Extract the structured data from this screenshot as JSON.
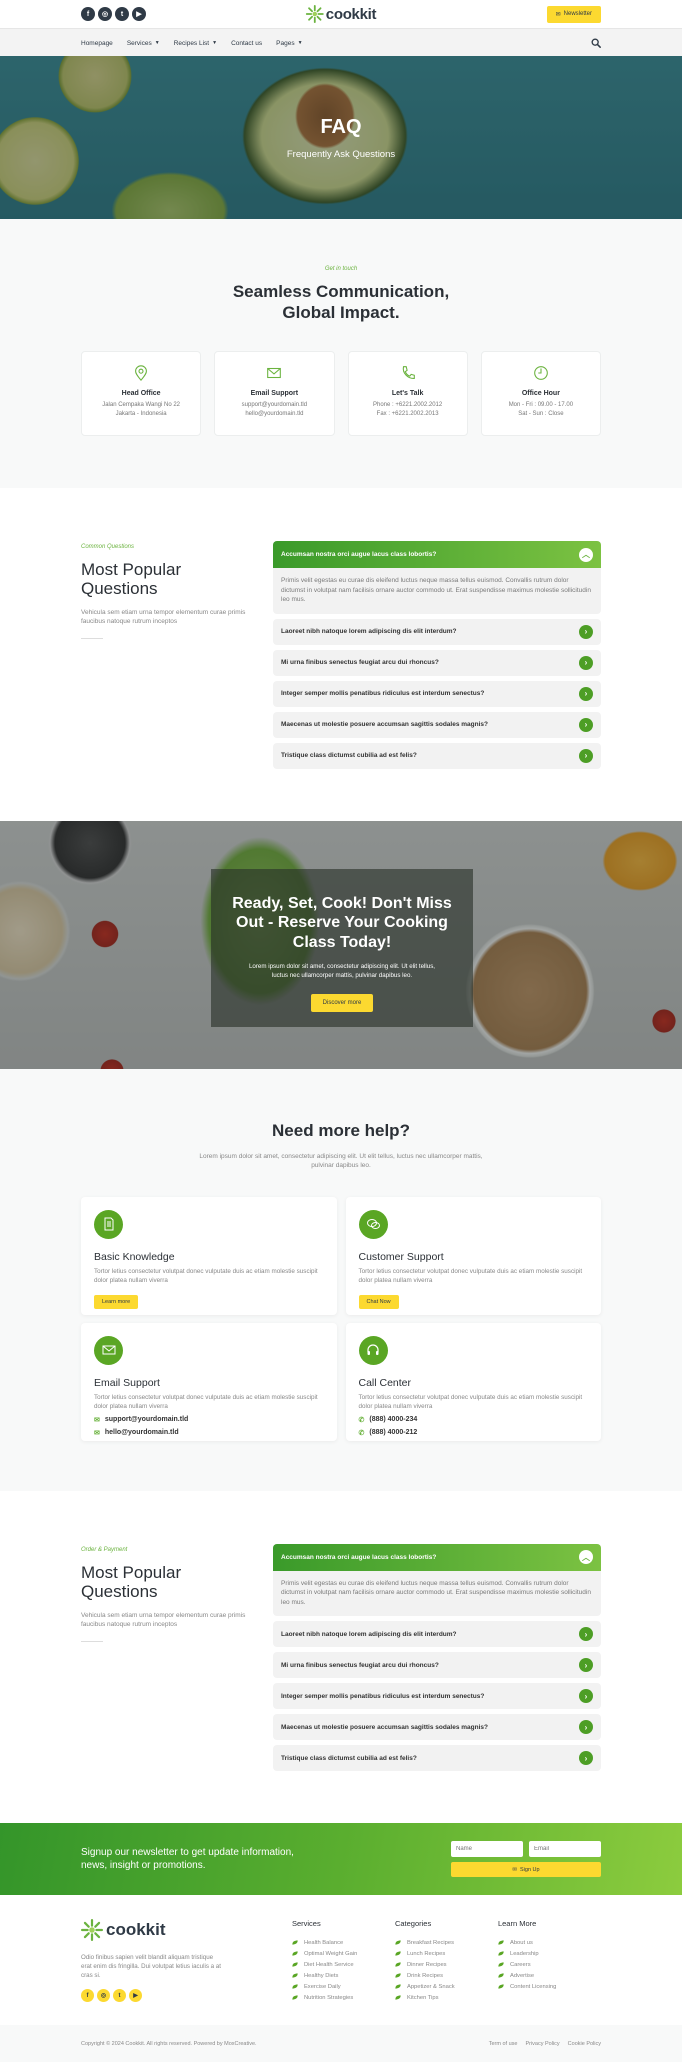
{
  "header": {
    "socials": [
      "facebook",
      "instagram",
      "twitter",
      "youtube"
    ],
    "brand": "cookkit",
    "newsletter_button": "Newsletter",
    "menu": [
      {
        "label": "Homepage",
        "dropdown": false
      },
      {
        "label": "Services",
        "dropdown": true
      },
      {
        "label": "Recipes List",
        "dropdown": true
      },
      {
        "label": "Contact us",
        "dropdown": false
      },
      {
        "label": "Pages",
        "dropdown": true
      }
    ]
  },
  "hero": {
    "title": "FAQ",
    "subtitle": "Frequently Ask Questions"
  },
  "contact": {
    "eyebrow": "Get in touch",
    "title": "Seamless Communication, Global Impact.",
    "cards": [
      {
        "icon": "map-pin-icon",
        "title": "Head Office",
        "lines": [
          "Jalan Cempaka Wangi No 22",
          "Jakarta - Indonesia"
        ]
      },
      {
        "icon": "envelope-icon",
        "title": "Email Support",
        "lines": [
          "support@yourdomain.tld",
          "hello@yourdomain.tld"
        ]
      },
      {
        "icon": "phone-icon",
        "title": "Let's Talk",
        "lines": [
          "Phone : +6221.2002.2012",
          "Fax : +6221.2002.2013"
        ]
      },
      {
        "icon": "clock-icon",
        "title": "Office Hour",
        "lines": [
          "Mon - Fri : 09.00 - 17.00",
          "Sat - Sun : Close"
        ]
      }
    ]
  },
  "faq1": {
    "eyebrow": "Common Questions",
    "title": "Most Popular Questions",
    "desc": "Vehicula sem etiam urna tempor elementum curae primis faucibus natoque rutrum inceptos",
    "open": {
      "question": "Accumsan nostra orci augue lacus class lobortis?",
      "answer": "Primis velit egestas eu curae dis eleifend luctus neque massa tellus euismod. Convallis rutrum dolor dictumst in volutpat nam facilisis ornare auctor commodo ut. Erat suspendisse maximus molestie sollicitudin leo mus."
    },
    "items": [
      "Laoreet nibh natoque lorem adipiscing dis elit interdum?",
      "Mi urna finibus senectus feugiat arcu dui rhoncus?",
      "Integer semper mollis penatibus ridiculus est interdum senectus?",
      "Maecenas ut molestie posuere accumsan sagittis sodales magnis?",
      "Tristique class dictumst cubilia ad est felis?"
    ]
  },
  "cta": {
    "title": "Ready, Set, Cook! Don't Miss Out - Reserve Your Cooking Class Today!",
    "text": "Lorem ipsum dolor sit amet, consectetur adipiscing elit. Ut elit tellus, luctus nec ullamcorper mattis, pulvinar dapibus leo.",
    "button": "Discover more"
  },
  "help": {
    "title": "Need more help?",
    "subtitle": "Lorem ipsum dolor sit amet, consectetur adipiscing elit. Ut elit tellus, luctus nec ullamcorper mattis, pulvinar dapibus leo.",
    "cards": [
      {
        "icon": "document-icon",
        "title": "Basic Knowledge",
        "text": "Tortor letius consectetur volutpat donec vulputate duis ac etiam molestie suscipit dolor platea nullam viverra",
        "button": "Learn more"
      },
      {
        "icon": "chat-bubbles-icon",
        "title": "Customer Support",
        "text": "Tortor letius consectetur volutpat donec vulputate duis ac etiam molestie suscipit dolor platea nullam viverra",
        "button": "Chat Now"
      },
      {
        "icon": "envelope-icon",
        "title": "Email Support",
        "text": "Tortor letius consectetur volutpat donec vulputate duis ac etiam molestie suscipit dolor platea nullam viverra",
        "contacts": [
          "support@yourdomain.tld",
          "hello@yourdomain.tld"
        ]
      },
      {
        "icon": "headset-icon",
        "title": "Call Center",
        "text": "Tortor letius consectetur volutpat donec vulputate duis ac etiam molestie suscipit dolor platea nullam viverra",
        "contacts": [
          "(888) 4000-234",
          "(888) 4000-212"
        ]
      }
    ]
  },
  "faq2": {
    "eyebrow": "Order & Payment",
    "title": "Most Popular Questions",
    "desc": "Vehicula sem etiam urna tempor elementum curae primis faucibus natoque rutrum inceptos",
    "open": {
      "question": "Accumsan nostra orci augue lacus class lobortis?",
      "answer": "Primis velit egestas eu curae dis eleifend luctus neque massa tellus euismod. Convallis rutrum dolor dictumst in volutpat nam facilisis ornare auctor commodo ut. Erat suspendisse maximus molestie sollicitudin leo mus."
    },
    "items": [
      "Laoreet nibh natoque lorem adipiscing dis elit interdum?",
      "Mi urna finibus senectus feugiat arcu dui rhoncus?",
      "Integer semper mollis penatibus ridiculus est interdum senectus?",
      "Maecenas ut molestie posuere accumsan sagittis sodales magnis?",
      "Tristique class dictumst cubilia ad est felis?"
    ]
  },
  "newsletter": {
    "message": "Signup our newsletter to get update information, news, insight or promotions.",
    "name_placeholder": "Name",
    "email_placeholder": "Email",
    "button": "Sign Up"
  },
  "footer": {
    "brand": "cookkit",
    "about": "Odio finibus sapien velit blandit aliquam tristique erat enim dis fringilla. Dui volutpat letius iaculis a at cras si.",
    "columns": [
      {
        "title": "Services",
        "links": [
          "Health Balance",
          "Optimal Weight Gain",
          "Diet Health Service",
          "Healthy Diets",
          "Exercise Daily",
          "Nutrition Strategies"
        ]
      },
      {
        "title": "Categories",
        "links": [
          "Breakfast Recipes",
          "Lunch Recipes",
          "Dinner Recipes",
          "Drink Recipes",
          "Appetizer & Snack",
          "Kitchen Tips"
        ]
      },
      {
        "title": "Learn More",
        "links": [
          "About us",
          "Leadership",
          "Careers",
          "Advertise",
          "Content Licensing"
        ]
      }
    ],
    "copyright": "Copyright © 2024 Cookkit. All rights reserved. Powered by MoxCreative.",
    "legal": [
      "Term of use",
      "Privacy Policy",
      "Cookie Policy"
    ]
  },
  "colors": {
    "brand_green": "#5aa624",
    "accent_yellow": "#fcd930",
    "dark": "#2f3a46"
  }
}
